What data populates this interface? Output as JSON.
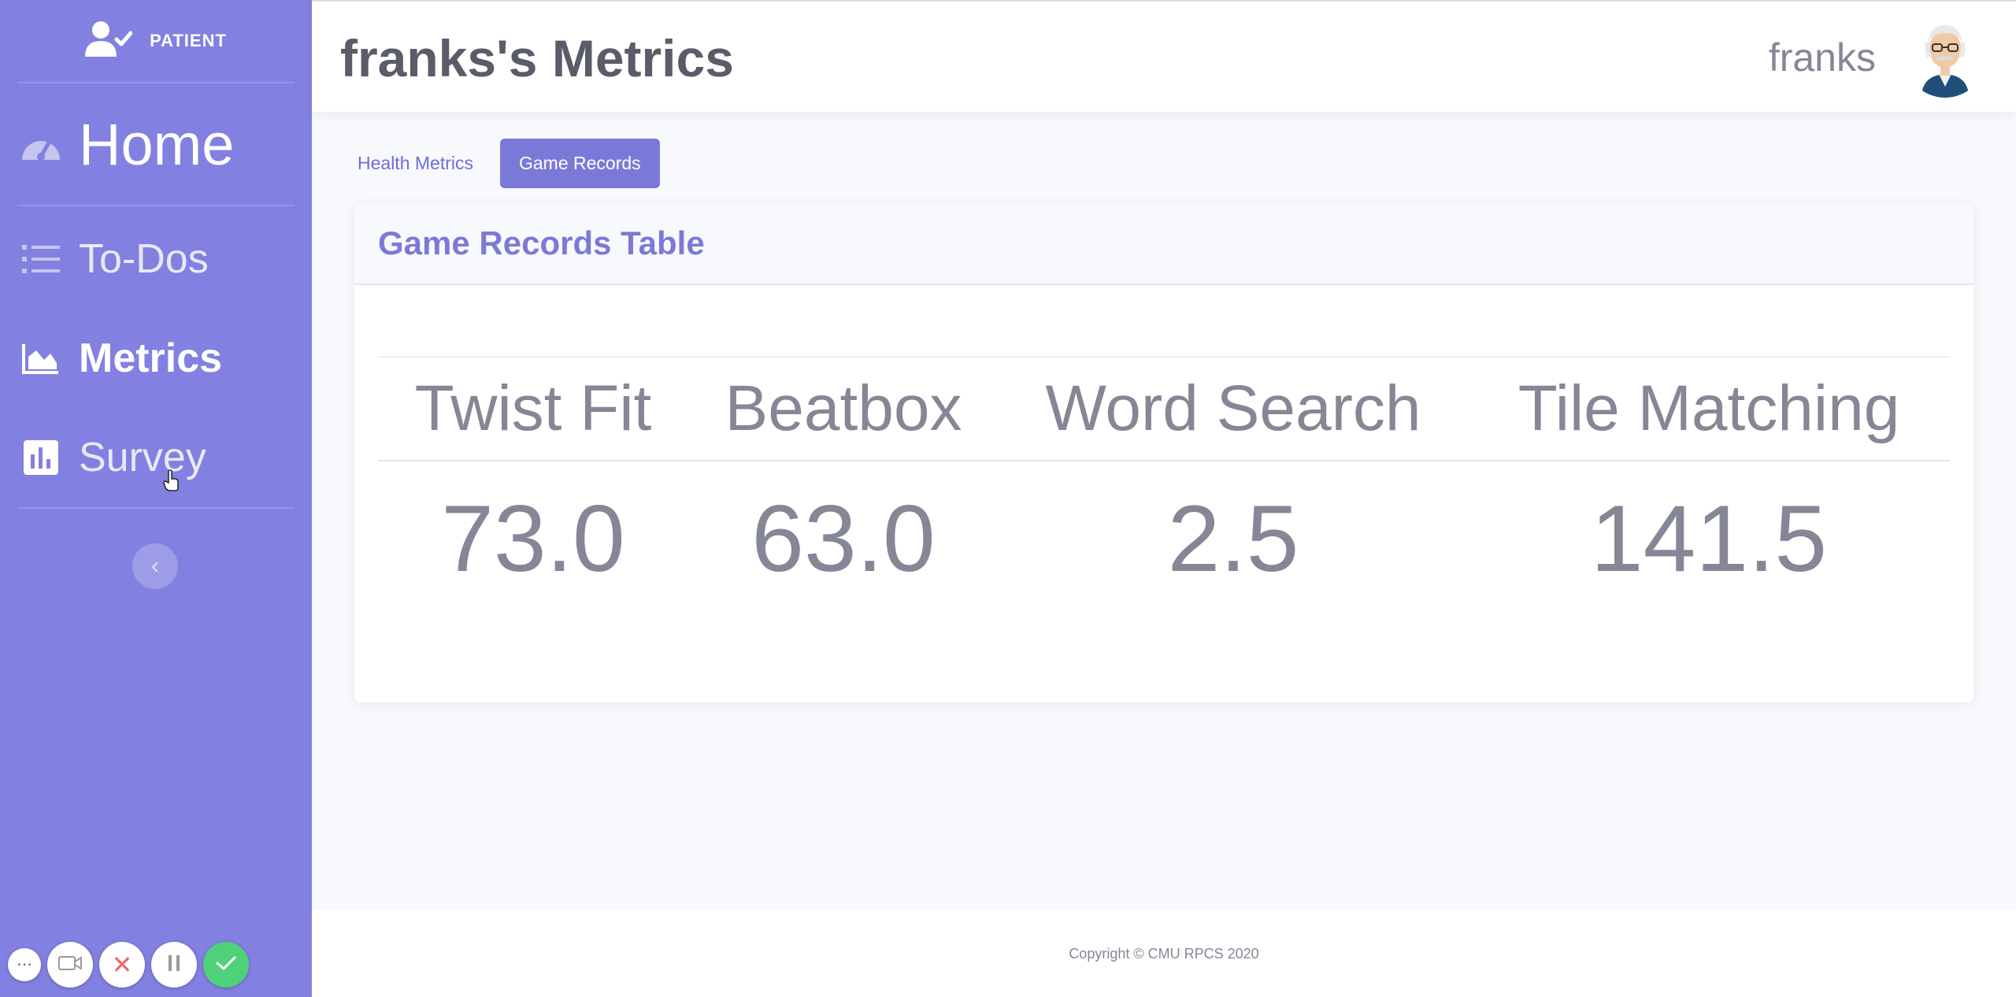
{
  "sidebar": {
    "brand": "PATIENT",
    "home": "Home",
    "items": [
      {
        "label": "To-Dos",
        "icon": "list-icon"
      },
      {
        "label": "Metrics",
        "icon": "area-chart-icon"
      },
      {
        "label": "Survey",
        "icon": "poll-icon"
      }
    ],
    "active_item": "Metrics",
    "collapse_icon": "chevron-left-icon"
  },
  "header": {
    "title": "franks's Metrics",
    "username": "franks"
  },
  "tabs": [
    {
      "label": "Health Metrics",
      "active": false
    },
    {
      "label": "Game Records",
      "active": true
    }
  ],
  "card": {
    "title": "Game Records Table",
    "columns": [
      "Twist Fit",
      "Beatbox",
      "Word Search",
      "Tile Matching"
    ],
    "values": [
      "73.0",
      "63.0",
      "2.5",
      "141.5"
    ]
  },
  "footer": {
    "copyright": "Copyright © CMU RPCS 2020"
  },
  "colors": {
    "sidebar": "#8280e0",
    "accent": "#7b79d8",
    "text_muted": "#858796",
    "record_confirm": "#4fd17a",
    "record_cancel": "#e86a6a"
  }
}
